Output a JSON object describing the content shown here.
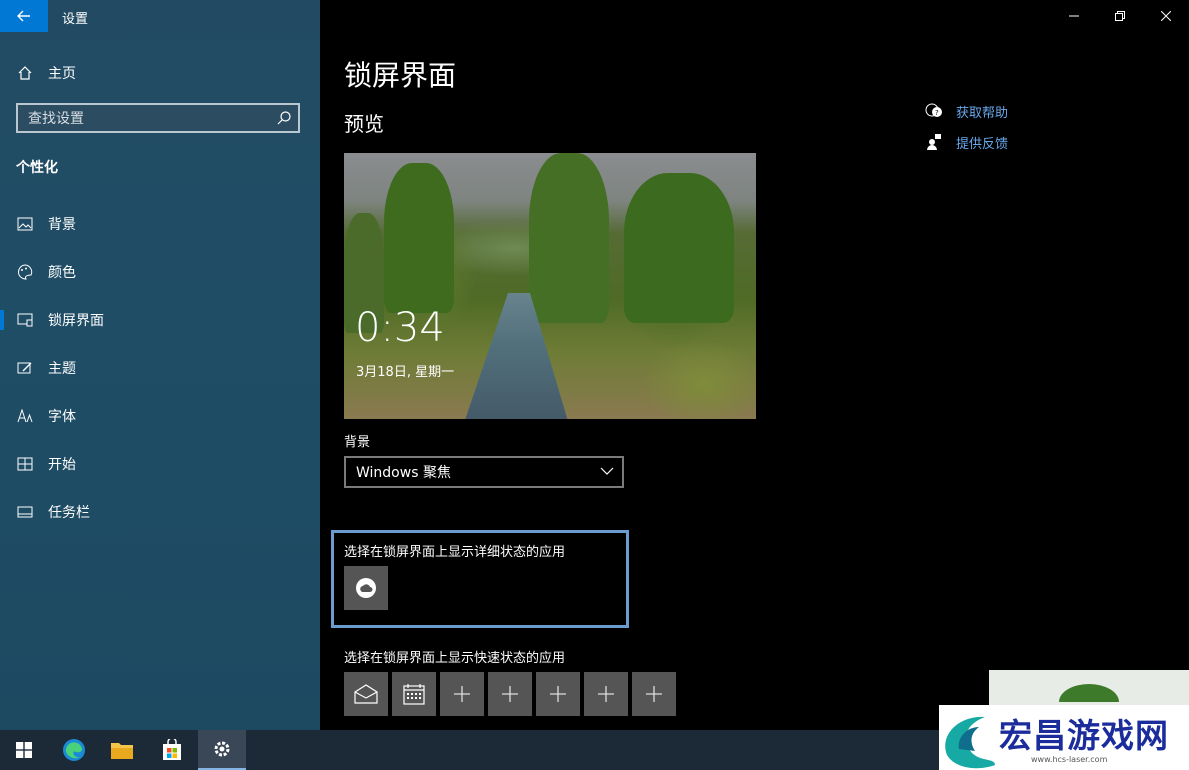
{
  "window": {
    "title": "设置"
  },
  "sidebar": {
    "home_label": "主页",
    "search_placeholder": "查找设置",
    "section_title": "个性化",
    "items": [
      {
        "label": "背景",
        "icon": "picture-icon"
      },
      {
        "label": "颜色",
        "icon": "palette-icon"
      },
      {
        "label": "锁屏界面",
        "icon": "lock-screen-icon",
        "active": true
      },
      {
        "label": "主题",
        "icon": "theme-brush-icon"
      },
      {
        "label": "字体",
        "icon": "font-icon"
      },
      {
        "label": "开始",
        "icon": "start-grid-icon"
      },
      {
        "label": "任务栏",
        "icon": "taskbar-icon"
      }
    ]
  },
  "main": {
    "page_title": "锁屏界面",
    "preview_title": "预览",
    "preview_time": "0:34",
    "preview_date": "3月18日, 星期一",
    "background_label": "背景",
    "background_value": "Windows 聚焦",
    "detailed_status_label": "选择在锁屏界面上显示详细状态的应用",
    "quick_status_label": "选择在锁屏界面上显示快速状态的应用",
    "quick_tiles": [
      "mail-icon",
      "calendar-icon",
      "plus-icon",
      "plus-icon",
      "plus-icon",
      "plus-icon",
      "plus-icon"
    ]
  },
  "help": {
    "get_help": "获取帮助",
    "feedback": "提供反馈"
  },
  "watermark": {
    "text": "宏昌游戏网",
    "url": "www.hcs-laser.com"
  },
  "colors": {
    "accent": "#0078d4",
    "link": "#68a8ec",
    "focus_border": "#6a9ccf"
  }
}
